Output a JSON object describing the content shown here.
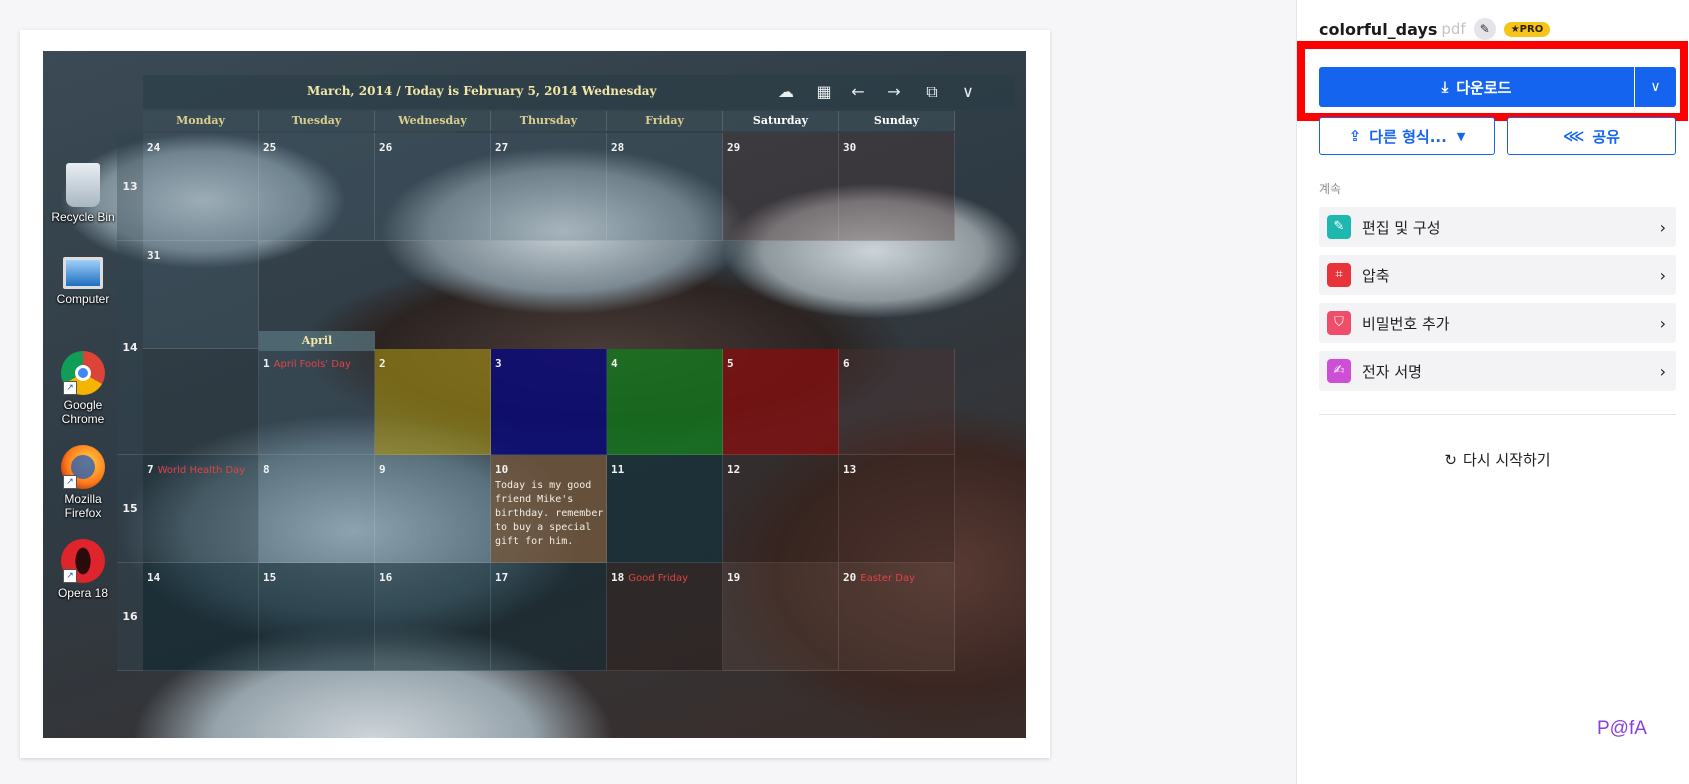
{
  "calendar": {
    "title": "March, 2014 / Today is February 5, 2014 Wednesday",
    "days": [
      "Monday",
      "Tuesday",
      "Wednesday",
      "Thursday",
      "Friday",
      "Saturday",
      "Sunday"
    ],
    "week_numbers": [
      "13",
      "14",
      "15",
      "16"
    ],
    "month_label": "April",
    "rows": [
      [
        "24",
        "25",
        "26",
        "27",
        "28",
        "29",
        "30"
      ],
      [
        "31",
        "",
        "",
        "",
        "",
        "",
        ""
      ],
      [
        "",
        "1",
        "2",
        "3",
        "4",
        "5",
        "6"
      ],
      [
        "7",
        "8",
        "9",
        "10",
        "11",
        "12",
        "13"
      ],
      [
        "14",
        "15",
        "16",
        "17",
        "18",
        "19",
        "20"
      ]
    ],
    "holidays": {
      "apr1": "April Fools' Day",
      "apr7": "World Health Day",
      "apr18": "Good Friday",
      "apr20": "Easter Day"
    },
    "note": "Today is my good friend Mike's birthday. remember to buy a special gift for him."
  },
  "desktop_icons": [
    "Recycle Bin",
    "Computer",
    "Google Chrome",
    "Mozilla Firefox",
    "Opera 18"
  ],
  "file": {
    "name": "colorful_days",
    "ext": "pdf",
    "badge": "★PRO"
  },
  "actions": {
    "download": "다운로드",
    "other_format": "다른 형식...",
    "share": "공유"
  },
  "continue_label": "계속",
  "tools": [
    {
      "label": "편집 및 구성",
      "color": "#1fb8b0"
    },
    {
      "label": "압축",
      "color": "#e8333a"
    },
    {
      "label": "비밀번호 추가",
      "color": "#ef4d6a"
    },
    {
      "label": "전자 서명",
      "color": "#cc4fd6"
    }
  ],
  "restart": "다시 시작하기",
  "brand": "P@fA"
}
